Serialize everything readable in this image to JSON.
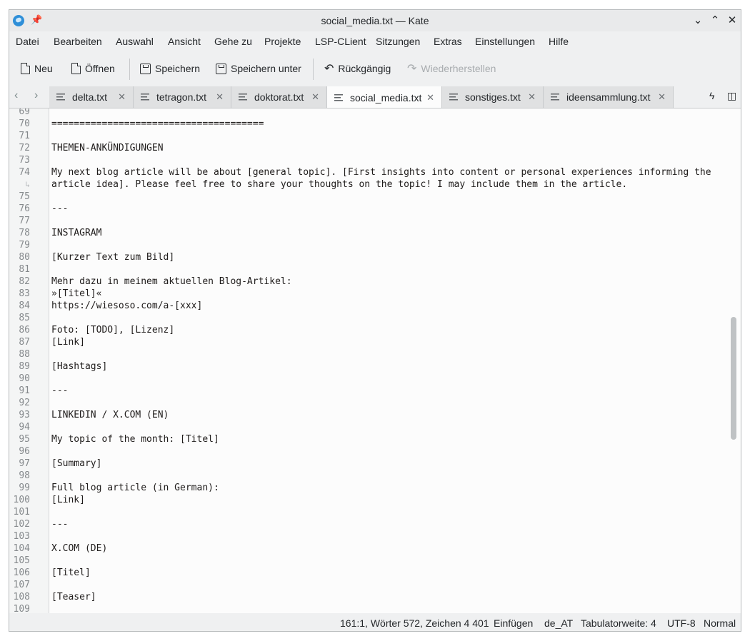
{
  "window": {
    "title": "social_media.txt — Kate"
  },
  "menu": [
    "Datei",
    "Bearbeiten",
    "Auswahl",
    "Ansicht",
    "Gehe zu",
    "Projekte",
    "LSP-CLient",
    "Sitzungen",
    "Extras",
    "Einstellungen",
    "Hilfe"
  ],
  "toolbar": {
    "new_label": "Neu",
    "open_label": "Öffnen",
    "save_label": "Speichern",
    "save_as_label": "Speichern unter",
    "undo_label": "Rückgängig",
    "redo_label": "Wiederherstellen"
  },
  "tabs": [
    {
      "label": "delta.txt",
      "active": false
    },
    {
      "label": "tetragon.txt",
      "active": false
    },
    {
      "label": "doktorat.txt",
      "active": false
    },
    {
      "label": "social_media.txt",
      "active": true
    },
    {
      "label": "sonstiges.txt",
      "active": false
    },
    {
      "label": "ideensammlung.txt",
      "active": false
    }
  ],
  "editor": {
    "lines": [
      {
        "num": "69",
        "text": ""
      },
      {
        "num": "70",
        "text": "======================================"
      },
      {
        "num": "71",
        "text": ""
      },
      {
        "num": "72",
        "text": "THEMEN-ANKÜNDIGUNGEN"
      },
      {
        "num": "73",
        "text": ""
      },
      {
        "num": "74",
        "text": "My next blog article will be about [general topic]. [First insights into content or personal experiences informing the"
      },
      {
        "num": "↳",
        "text": "article idea]. Please feel free to share your thoughts on the topic! I may include them in the article.",
        "wrap": true
      },
      {
        "num": "75",
        "text": ""
      },
      {
        "num": "76",
        "text": "---"
      },
      {
        "num": "77",
        "text": ""
      },
      {
        "num": "78",
        "text": "INSTAGRAM"
      },
      {
        "num": "79",
        "text": ""
      },
      {
        "num": "80",
        "text": "[Kurzer Text zum Bild]"
      },
      {
        "num": "81",
        "text": ""
      },
      {
        "num": "82",
        "text": "Mehr dazu in meinem aktuellen Blog-Artikel:"
      },
      {
        "num": "83",
        "text": "»[Titel]«"
      },
      {
        "num": "84",
        "text": "https://wiesoso.com/a-[xxx]"
      },
      {
        "num": "85",
        "text": ""
      },
      {
        "num": "86",
        "text": "Foto: [TODO], [Lizenz]"
      },
      {
        "num": "87",
        "text": "[Link]"
      },
      {
        "num": "88",
        "text": ""
      },
      {
        "num": "89",
        "text": "[Hashtags]"
      },
      {
        "num": "90",
        "text": ""
      },
      {
        "num": "91",
        "text": "---"
      },
      {
        "num": "92",
        "text": ""
      },
      {
        "num": "93",
        "text": "LINKEDIN / X.COM (EN)"
      },
      {
        "num": "94",
        "text": ""
      },
      {
        "num": "95",
        "text": "My topic of the month: [Titel]"
      },
      {
        "num": "96",
        "text": ""
      },
      {
        "num": "97",
        "text": "[Summary]"
      },
      {
        "num": "98",
        "text": ""
      },
      {
        "num": "99",
        "text": "Full blog article (in German):"
      },
      {
        "num": "100",
        "text": "[Link]"
      },
      {
        "num": "101",
        "text": ""
      },
      {
        "num": "102",
        "text": "---"
      },
      {
        "num": "103",
        "text": ""
      },
      {
        "num": "104",
        "text": "X.COM (DE)"
      },
      {
        "num": "105",
        "text": ""
      },
      {
        "num": "106",
        "text": "[Titel]"
      },
      {
        "num": "107",
        "text": ""
      },
      {
        "num": "108",
        "text": "[Teaser]"
      },
      {
        "num": "109",
        "text": ""
      }
    ]
  },
  "status": {
    "cursor": "161:1, Wörter 572, Zeichen 4 401",
    "mode": "Einfügen",
    "language": "de_AT",
    "tab_width": "Tabulatorweite: 4",
    "encoding": "UTF-8",
    "input_mode": "Normal"
  }
}
